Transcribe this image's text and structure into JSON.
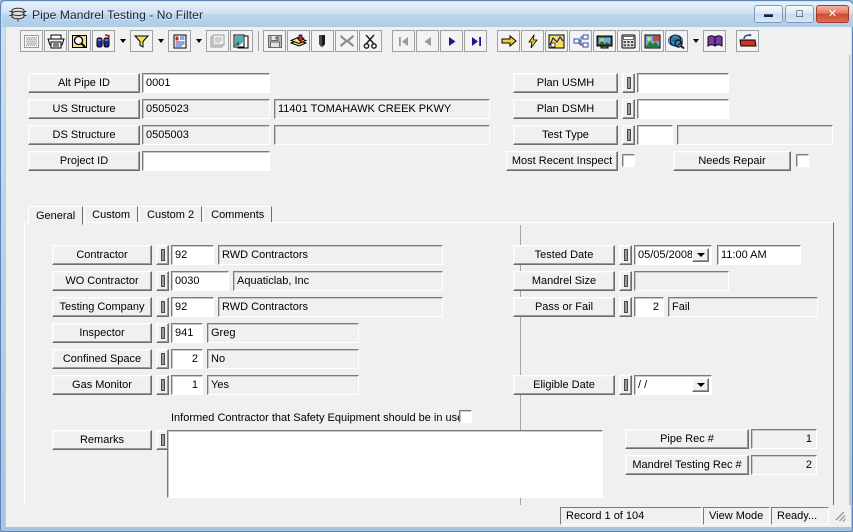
{
  "window": {
    "title": "Pipe Mandrel Testing - No Filter",
    "icon": "pipe-stack-icon",
    "buttons": {
      "minimize": "–",
      "maximize": "□",
      "close": "✕"
    }
  },
  "toolbar": {
    "items": [
      {
        "name": "print-preview-grid-icon",
        "label": "Print Preview",
        "enabled": false
      },
      {
        "name": "print-icon",
        "label": "Print",
        "enabled": true
      },
      {
        "name": "search-magnifier-icon",
        "label": "Find",
        "enabled": true
      },
      {
        "name": "binoculars-find-icon",
        "label": "Find Record",
        "enabled": true
      },
      {
        "name": "dropdown-arrow-find",
        "label": "",
        "enabled": true
      },
      {
        "name": "filter-funnel-icon",
        "label": "Filter",
        "enabled": true
      },
      {
        "name": "dropdown-arrow-filter",
        "label": "",
        "enabled": true
      },
      {
        "name": "report-document-icon",
        "label": "Report",
        "enabled": true
      },
      {
        "name": "dropdown-arrow-report",
        "label": "",
        "enabled": true
      },
      {
        "name": "properties-icon",
        "label": "Properties",
        "enabled": false
      },
      {
        "name": "copy-pages-icon",
        "label": "Copy",
        "enabled": true
      },
      {
        "name": "save-disk-icon",
        "label": "Save",
        "enabled": false
      },
      {
        "name": "add-record-icon",
        "label": "Add Record",
        "enabled": true
      },
      {
        "name": "edit-pencil-icon",
        "label": "Edit",
        "enabled": true
      },
      {
        "name": "delete-x-icon",
        "label": "Delete",
        "enabled": false
      },
      {
        "name": "cut-scissors-icon",
        "label": "Cut",
        "enabled": true
      },
      {
        "name": "nav-first-icon",
        "label": "First Record",
        "enabled": false
      },
      {
        "name": "nav-prev-icon",
        "label": "Previous Record",
        "enabled": false
      },
      {
        "name": "nav-next-icon",
        "label": "Next Record",
        "enabled": true
      },
      {
        "name": "nav-last-icon",
        "label": "Last Record",
        "enabled": true
      },
      {
        "name": "goto-arrow-icon",
        "label": "Go To",
        "enabled": true
      },
      {
        "name": "lightning-icon",
        "label": "Quick Action",
        "enabled": true
      },
      {
        "name": "map-view-icon",
        "label": "Map",
        "enabled": true
      },
      {
        "name": "tree-view-icon",
        "label": "Tree View",
        "enabled": true
      },
      {
        "name": "video-monitor-icon",
        "label": "Video",
        "enabled": true
      },
      {
        "name": "calculator-icon",
        "label": "Calculator",
        "enabled": true
      },
      {
        "name": "image-view-icon",
        "label": "Images",
        "enabled": true
      },
      {
        "name": "globe-search-icon",
        "label": "GIS",
        "enabled": true
      },
      {
        "name": "dropdown-arrow-gis",
        "label": "",
        "enabled": true
      },
      {
        "name": "help-book-icon",
        "label": "Help",
        "enabled": true
      },
      {
        "name": "exit-door-icon",
        "label": "Exit",
        "enabled": true
      }
    ]
  },
  "header": {
    "left_rows": [
      {
        "label": "Alt Pipe ID",
        "value": "0001",
        "readonly": false,
        "desc": null,
        "desc_readonly": true
      },
      {
        "label": "US Structure",
        "value": "0505023",
        "readonly": true,
        "desc": "11401    TOMAHAWK CREEK PKWY",
        "desc_readonly": true
      },
      {
        "label": "DS Structure",
        "value": "0505003",
        "readonly": true,
        "desc": "",
        "desc_readonly": true
      },
      {
        "label": "Project ID",
        "value": "",
        "readonly": false,
        "desc": null,
        "desc_readonly": true
      }
    ],
    "right_rows": [
      {
        "label": "Plan USMH",
        "value": ""
      },
      {
        "label": "Plan DSMH",
        "value": ""
      },
      {
        "label": "Test Type",
        "code": "",
        "desc": ""
      }
    ],
    "most_recent_inspect": {
      "label": "Most Recent Inspect",
      "checked": false
    },
    "needs_repair": {
      "label": "Needs Repair",
      "checked": false
    }
  },
  "tabs": {
    "items": [
      "General",
      "Custom",
      "Custom 2",
      "Comments"
    ],
    "active_index": 0
  },
  "general": {
    "left_rows": [
      {
        "label": "Contractor",
        "code": "92",
        "desc": "RWD Contractors",
        "code_ro": false,
        "desc_ro": true,
        "code_align": "left"
      },
      {
        "label": "WO Contractor",
        "code": "0030",
        "desc": "Aquaticlab, Inc",
        "code_ro": false,
        "desc_ro": true,
        "code_align": "left"
      },
      {
        "label": "Testing Company",
        "code": "92",
        "desc": "RWD Contractors",
        "code_ro": false,
        "desc_ro": true,
        "code_align": "left"
      },
      {
        "label": "Inspector",
        "code": "941",
        "desc": "Greg",
        "code_ro": false,
        "desc_ro": true,
        "code_align": "left"
      },
      {
        "label": "Confined Space",
        "code": "2",
        "desc": "No",
        "code_ro": false,
        "desc_ro": true,
        "code_align": "right"
      },
      {
        "label": "Gas Monitor",
        "code": "1",
        "desc": "Yes",
        "code_ro": false,
        "desc_ro": true,
        "code_align": "right"
      }
    ],
    "safety_note": {
      "label": "Informed Contractor that Safety Equipment should be in use",
      "checked": false
    },
    "remarks": {
      "label": "Remarks",
      "value": ""
    },
    "right": {
      "tested_date": {
        "label": "Tested Date",
        "date": "05/05/2008",
        "time": "11:00 AM"
      },
      "mandrel_size": {
        "label": "Mandrel Size",
        "value": ""
      },
      "pass_or_fail": {
        "label": "Pass or Fail",
        "code": "2",
        "desc": "Fail"
      },
      "eligible_date": {
        "label": "Eligible Date",
        "date": "/  /"
      },
      "pipe_rec": {
        "label": "Pipe Rec #",
        "value": "1"
      },
      "mandrel_rec": {
        "label": "Mandrel Testing Rec #",
        "value": "2"
      }
    }
  },
  "statusbar": {
    "record": "Record 1 of 104",
    "mode": "View Mode",
    "state": "Ready...",
    "grip": "resize-grip-icon"
  },
  "colors": {
    "window_frame": "#5b86b5",
    "titlebar_top": "#e8f1fa",
    "titlebar_bottom": "#aecbe6",
    "client_bg": "#f0f0f0",
    "field_bg": "#ffffff",
    "readonly_bg": "#f0f0f0",
    "close_button": "#cf4a31"
  }
}
